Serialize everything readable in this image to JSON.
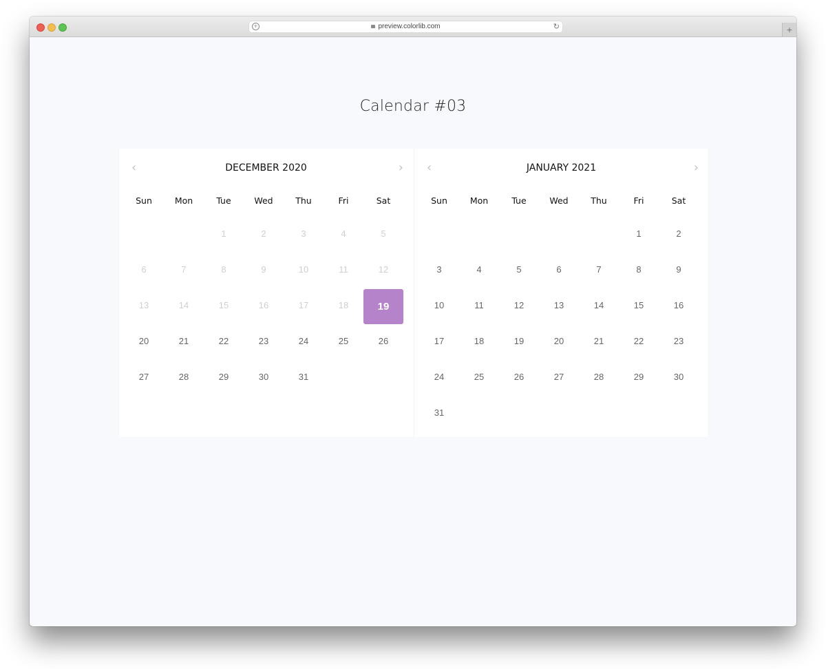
{
  "browser": {
    "url": "preview.colorlib.com",
    "new_tab_symbol": "+",
    "reload_symbol": "↻",
    "add_symbol": "+"
  },
  "page": {
    "title": "Calendar #03"
  },
  "colors": {
    "accent": "#b583c9",
    "page_bg": "#f8f9fc",
    "past_day": "#cfcfcf",
    "day": "#666666"
  },
  "calendar": {
    "prev_icon": "‹",
    "next_icon": "›",
    "weekdays": [
      "Sun",
      "Mon",
      "Tue",
      "Wed",
      "Thu",
      "Fri",
      "Sat"
    ],
    "selected_date": "19",
    "months": [
      {
        "label": "DECEMBER 2020",
        "weeks": [
          [
            "",
            "",
            "1",
            "2",
            "3",
            "4",
            "5"
          ],
          [
            "6",
            "7",
            "8",
            "9",
            "10",
            "11",
            "12"
          ],
          [
            "13",
            "14",
            "15",
            "16",
            "17",
            "18",
            "19"
          ],
          [
            "20",
            "21",
            "22",
            "23",
            "24",
            "25",
            "26"
          ],
          [
            "27",
            "28",
            "29",
            "30",
            "31",
            "",
            ""
          ]
        ],
        "past_days_through": 18,
        "selected": "19"
      },
      {
        "label": "JANUARY 2021",
        "weeks": [
          [
            "",
            "",
            "",
            "",
            "",
            "1",
            "2"
          ],
          [
            "3",
            "4",
            "5",
            "6",
            "7",
            "8",
            "9"
          ],
          [
            "10",
            "11",
            "12",
            "13",
            "14",
            "15",
            "16"
          ],
          [
            "17",
            "18",
            "19",
            "20",
            "21",
            "22",
            "23"
          ],
          [
            "24",
            "25",
            "26",
            "27",
            "28",
            "29",
            "30"
          ],
          [
            "31",
            "",
            "",
            "",
            "",
            "",
            ""
          ]
        ],
        "past_days_through": 0,
        "selected": ""
      }
    ]
  }
}
